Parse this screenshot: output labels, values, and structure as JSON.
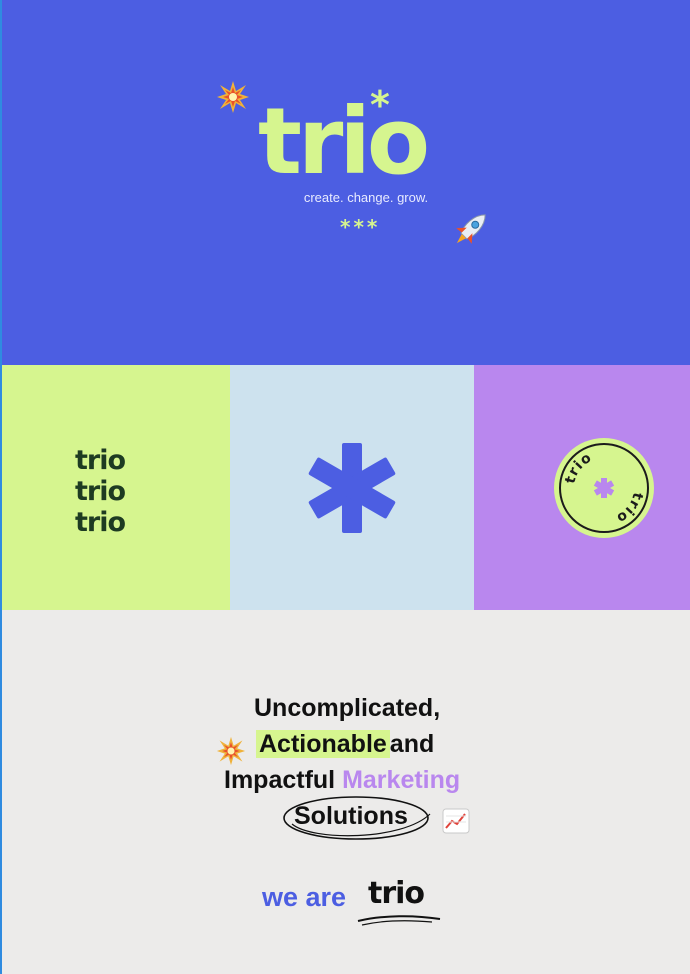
{
  "hero": {
    "logo": "trio",
    "logo_star": "*",
    "tagline": "create. change. grow.",
    "stars": "***"
  },
  "panels": {
    "stack_words": [
      "trio",
      "trio",
      "trio"
    ],
    "badge_text": "trio trio"
  },
  "headline": {
    "line1": "Uncomplicated,",
    "line2_highlight": "Actionable",
    "line2_rest": "and",
    "line3_a": "Impactful",
    "line3_b": "Marketing",
    "line4": "Solutions"
  },
  "footer": {
    "we_are": "we are",
    "brand": "trio"
  },
  "icons": {
    "sparkle": "burst-icon",
    "rocket": "rocket-icon",
    "chart": "chart-increasing-icon"
  },
  "colors": {
    "hero_bg": "#4c5ee2",
    "lime": "#d6f58f",
    "light_blue": "#cde2ee",
    "lavender": "#b987ee",
    "bottom_bg": "#ecebea"
  }
}
